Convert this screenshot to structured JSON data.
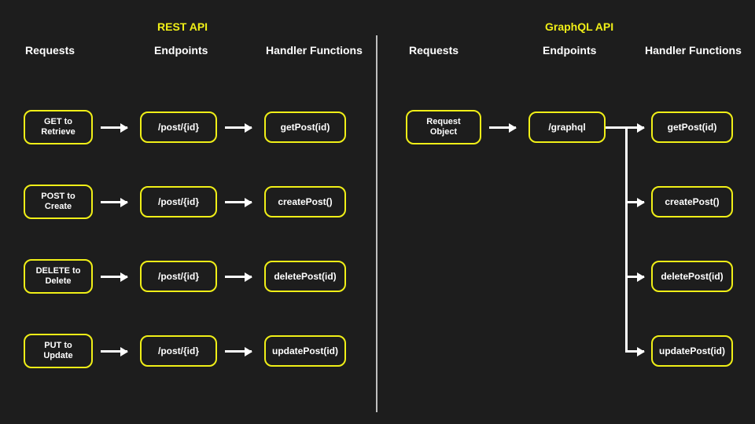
{
  "rest": {
    "title": "REST API",
    "columns": {
      "requests": "Requests",
      "endpoints": "Endpoints",
      "handlers": "Handler Functions"
    },
    "rows": [
      {
        "request": "GET to Retrieve",
        "endpoint": "/post/{id}",
        "handler": "getPost(id)"
      },
      {
        "request": "POST to Create",
        "endpoint": "/post/{id}",
        "handler": "createPost()"
      },
      {
        "request": "DELETE to Delete",
        "endpoint": "/post/{id}",
        "handler": "deletePost(id)"
      },
      {
        "request": "PUT to Update",
        "endpoint": "/post/{id}",
        "handler": "updatePost(id)"
      }
    ]
  },
  "graphql": {
    "title": "GraphQL API",
    "columns": {
      "requests": "Requests",
      "endpoints": "Endpoints",
      "handlers": "Handler Functions"
    },
    "request": "Request Object",
    "endpoint": "/graphql",
    "handlers": [
      "getPost(id)",
      "createPost()",
      "deletePost(id)",
      "updatePost(id)"
    ]
  }
}
